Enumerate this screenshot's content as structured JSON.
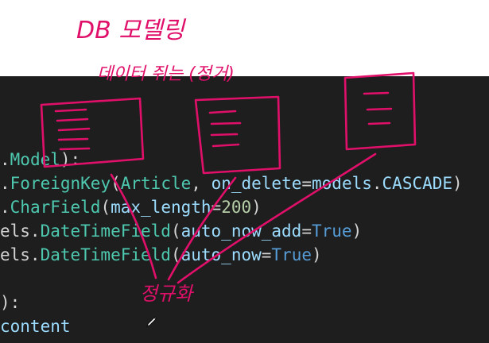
{
  "annotations": {
    "title": "DB 모델링",
    "subtitle": "데이터 쥐는 (정거)",
    "bottom_label": "정규화"
  },
  "code": {
    "lines": [
      [
        {
          "t": ".",
          "c": "plain"
        },
        {
          "t": "Model",
          "c": "class"
        },
        {
          "t": "):",
          "c": "plain"
        }
      ],
      [
        {
          "t": ".",
          "c": "plain"
        },
        {
          "t": "ForeignKey",
          "c": "class"
        },
        {
          "t": "(",
          "c": "paren"
        },
        {
          "t": "Article",
          "c": "class"
        },
        {
          "t": ", ",
          "c": "plain"
        },
        {
          "t": "on_delete",
          "c": "param"
        },
        {
          "t": "=",
          "c": "plain"
        },
        {
          "t": "models",
          "c": "ident"
        },
        {
          "t": ".",
          "c": "plain"
        },
        {
          "t": "CASCADE",
          "c": "ident"
        },
        {
          "t": ")",
          "c": "paren"
        }
      ],
      [
        {
          "t": ".",
          "c": "plain"
        },
        {
          "t": "CharField",
          "c": "class"
        },
        {
          "t": "(",
          "c": "paren"
        },
        {
          "t": "max_length",
          "c": "param"
        },
        {
          "t": "=",
          "c": "plain"
        },
        {
          "t": "200",
          "c": "number"
        },
        {
          "t": ")",
          "c": "paren"
        }
      ],
      [
        {
          "t": "els.",
          "c": "plain"
        },
        {
          "t": "DateTimeField",
          "c": "class"
        },
        {
          "t": "(",
          "c": "paren"
        },
        {
          "t": "auto_now_add",
          "c": "param"
        },
        {
          "t": "=",
          "c": "plain"
        },
        {
          "t": "True",
          "c": "keyword"
        },
        {
          "t": ")",
          "c": "paren"
        }
      ],
      [
        {
          "t": "els.",
          "c": "plain"
        },
        {
          "t": "DateTimeField",
          "c": "class"
        },
        {
          "t": "(",
          "c": "paren"
        },
        {
          "t": "auto_now",
          "c": "param"
        },
        {
          "t": "=",
          "c": "plain"
        },
        {
          "t": "True",
          "c": "keyword"
        },
        {
          "t": ")",
          "c": "paren"
        }
      ],
      [],
      [
        {
          "t": "):",
          "c": "plain"
        }
      ],
      [
        {
          "t": "content",
          "c": "ident"
        }
      ]
    ]
  },
  "colors": {
    "ink": "#e0106a",
    "editor_background": "#1e1e1e",
    "class_token": "#4ec9b0",
    "param_token": "#9cdcfe",
    "keyword_token": "#569cd6",
    "number_token": "#b5cea8"
  },
  "icons": {
    "cursor": "pen-cursor-icon"
  }
}
